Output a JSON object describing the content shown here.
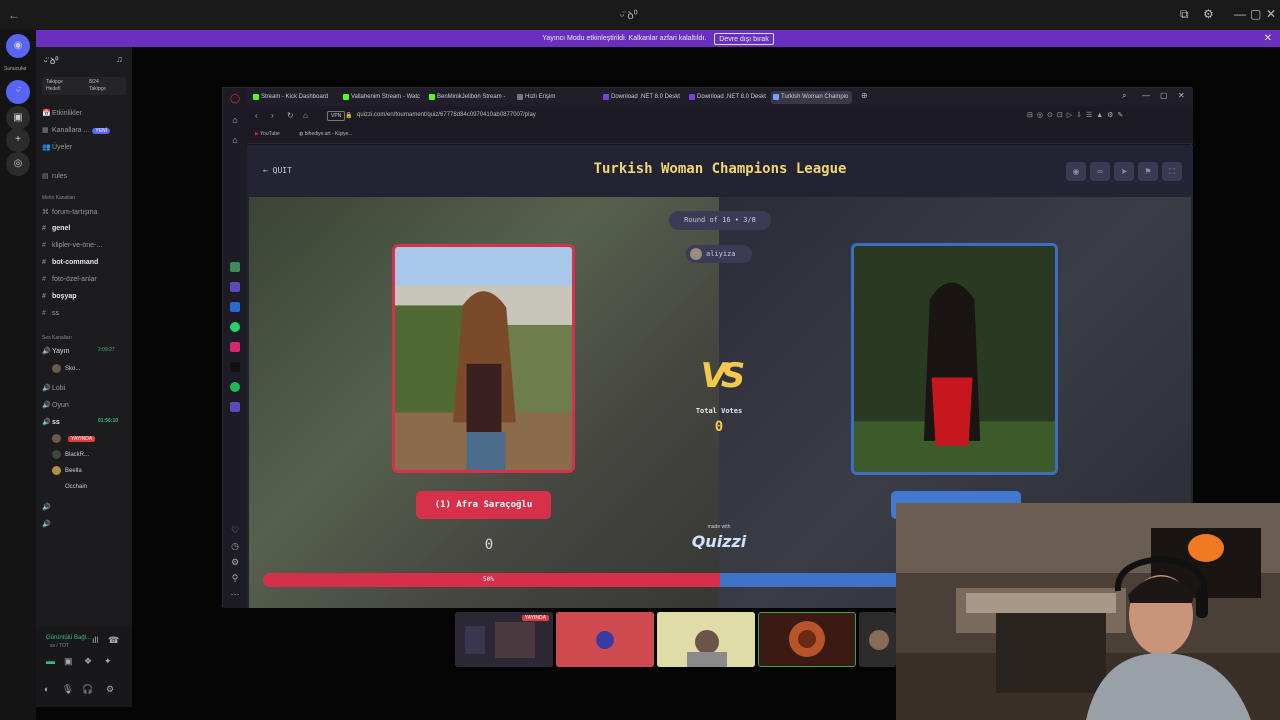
{
  "os_bar": {
    "center": "ᵕ̈ ꝺ⁰",
    "controls": [
      "⧉",
      "⚙",
      "—",
      "▢",
      "✕"
    ]
  },
  "notice": {
    "text": "Yayıncı Modu etkinleştirildi. Kalkanlar azfari kalaltıldı.",
    "button": "Devre dışı bırak",
    "close": "✕"
  },
  "rail": {
    "label": "Sunucular"
  },
  "sidebar": {
    "server": "ᵕ̈ ꝺ⁰",
    "goal": {
      "left1": "Takipçe",
      "left2": "Hedefi",
      "right1": "8/24",
      "right2": "Takipçe"
    },
    "items": [
      {
        "label": "Etkinlikler",
        "icon": "📅"
      },
      {
        "label": "Kanallara ...",
        "icon": "▦",
        "tag": "YENİ"
      },
      {
        "label": "Üyeler",
        "icon": "👥"
      },
      {
        "label": "rules",
        "icon": "▤"
      }
    ],
    "text_category": "Metin Kanalları",
    "channels": [
      {
        "label": "forum-tartışma",
        "icon": "⌘",
        "bold": false
      },
      {
        "label": "genel",
        "icon": "#",
        "bold": true
      },
      {
        "label": "klipler-ve-öne-...",
        "icon": "#",
        "bold": false
      },
      {
        "label": "bot-command",
        "icon": "#",
        "bold": true
      },
      {
        "label": "foto-özel-anlar",
        "icon": "#",
        "bold": false
      },
      {
        "label": "boşyap",
        "icon": "#",
        "bold": true
      },
      {
        "label": "ss",
        "icon": "#",
        "bold": false
      }
    ],
    "voice_category": "Ses Kanalları",
    "voice": [
      {
        "label": "Yayın",
        "time": "2:09:27"
      },
      {
        "label": "Lobi",
        "time": ""
      },
      {
        "label": "Oyun",
        "time": ""
      },
      {
        "label": "ss",
        "time": "01:56:10"
      }
    ],
    "users_top": [
      {
        "name": "Sko..."
      }
    ],
    "users": [
      {
        "name": "",
        "live": "YAYINDA"
      },
      {
        "name": "BlackR...",
        "live": ""
      },
      {
        "name": "Beella",
        "live": ""
      },
      {
        "name": "Occhain",
        "live": ""
      }
    ],
    "voice_bar": {
      "status": "Görüntülü Bağl...",
      "sub": "ss / TOT"
    }
  },
  "browser": {
    "tabs": [
      {
        "label": "Stream - Kick Dashboard",
        "color": "#53fc18"
      },
      {
        "label": "Vallahenim Stream - Watc",
        "color": "#53fc18"
      },
      {
        "label": "BenMinikJelibon Stream -",
        "color": "#53fc18"
      },
      {
        "label": "Hızlı Erişim",
        "color": "#777777"
      },
      {
        "label": "Download .NET 8.0 Deskt",
        "color": "#7b3fe4"
      },
      {
        "label": "Download .NET 8.0 Deskt",
        "color": "#7b3fe4"
      },
      {
        "label": "Turkish Woman Champio",
        "color": "#6fa0ff"
      }
    ],
    "url": "quizzi.com/en/tournament/quiz/67778d84c0970410ab0877007/play",
    "vpn": "VPN",
    "bookmarks": [
      "YouTube",
      "bihediye.art - Kişiye..."
    ]
  },
  "quiz": {
    "quit": "QUIT",
    "title": "Turkish Woman Champions League",
    "round": "Round of 16 • 3/8",
    "creator": "aliyiza",
    "left_name": "(1) Afra Saraçoğlu",
    "left_votes": "0",
    "total_label": "Total Votes",
    "total_votes": "0",
    "made_with": "made with",
    "logo": "Quizzi",
    "vs": "VS",
    "progress_left_percent": 50,
    "progress_label": "50%"
  },
  "thumbnails": [
    {
      "live": "YAYINDA"
    },
    {
      "live": ""
    },
    {
      "live": ""
    },
    {
      "live": ""
    },
    {
      "live": ""
    }
  ],
  "colors": {
    "accent_red": "#d7304a",
    "accent_blue": "#3e6dc6",
    "title_yellow": "#f0d76e",
    "notice_purple": "#6b2fbf"
  }
}
